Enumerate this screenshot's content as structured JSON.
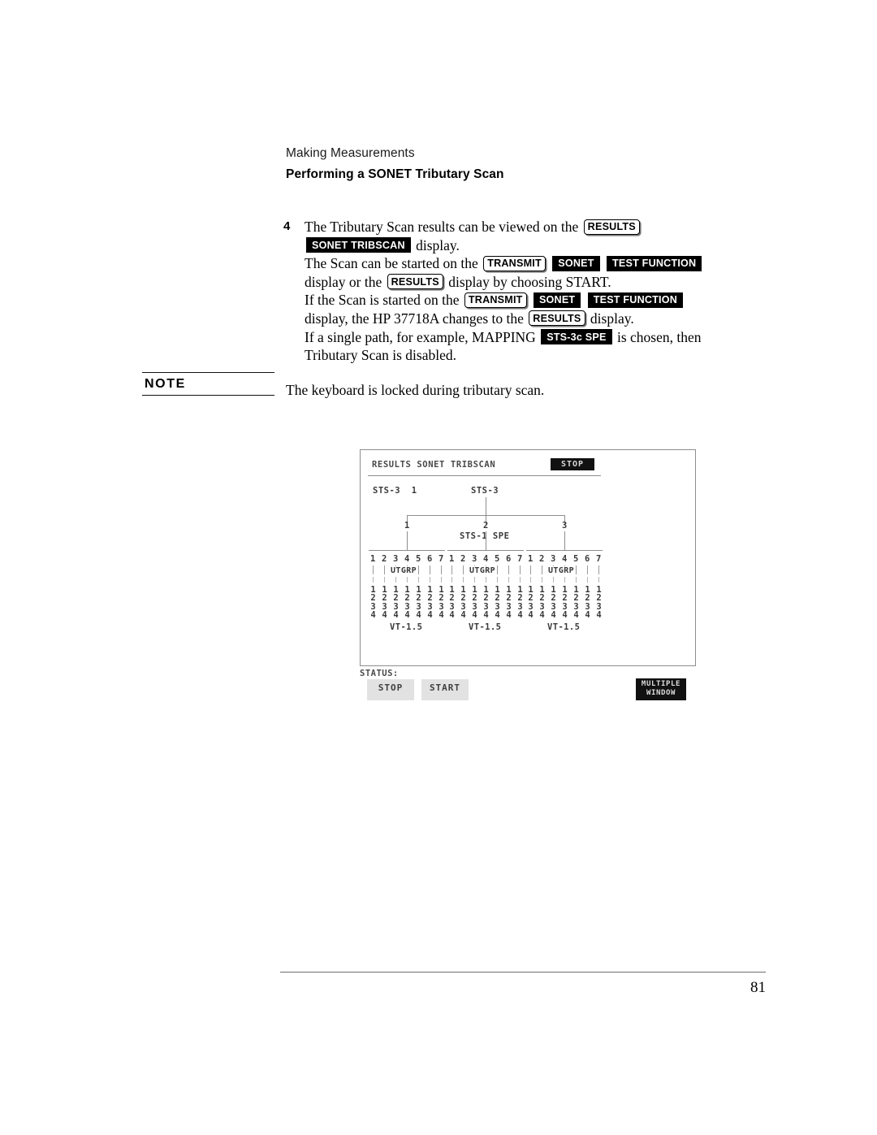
{
  "header": {
    "chapter": "Making Measurements",
    "section": "Performing a SONET Tributary Scan"
  },
  "step": {
    "number": "4",
    "line1_a": "The Tributary Scan results can be viewed on the",
    "key_results_1": "RESULTS",
    "line2_key": "SONET TRIBSCAN",
    "line2_b": "display.",
    "line3_a": "The Scan can be started on the",
    "key_transmit_1": "TRANSMIT",
    "key_sonet_1": "SONET",
    "key_testfn_1": "TEST FUNCTION",
    "line4_a": "display or the",
    "key_results_2": "RESULTS",
    "line4_b": "display by choosing START.",
    "line5_a": "If the Scan is started on the",
    "key_transmit_2": "TRANSMIT",
    "key_sonet_2": "SONET",
    "key_testfn_2": "TEST FUNCTION",
    "line6_a": "display, the HP 37718A changes to the",
    "key_results_3": "RESULTS",
    "line6_b": "display.",
    "line7_a": "If a single path, for example, MAPPING",
    "key_sts3c": "STS-3c SPE",
    "line7_b": "is chosen, then",
    "line8": "Tributary Scan is disabled."
  },
  "note": {
    "label": "NOTE",
    "text": "The keyboard is locked during tributary scan."
  },
  "figure": {
    "screen_title": "RESULTS  SONET TRIBSCAN",
    "stop_indicator": "STOP",
    "sts3_left_label": "STS-3",
    "sts3_left_index": "1",
    "sts3_center_label": "STS-3",
    "branch_labels": [
      "1",
      "2",
      "3"
    ],
    "sts1_spe_label": "STS-1 SPE",
    "utgrp_label": "UTGRP",
    "utgrp_numbers": [
      "1",
      "2",
      "3",
      "4",
      "5",
      "6",
      "7"
    ],
    "vt_digits": [
      "1",
      "2",
      "3",
      "4"
    ],
    "vt_label": "VT-1.5",
    "status_label": "STATUS:",
    "softkeys": [
      "STOP",
      "START"
    ],
    "multiple_window": {
      "line1": "MULTIPLE",
      "line2": "WINDOW"
    }
  },
  "footer": {
    "page_number": "81"
  }
}
